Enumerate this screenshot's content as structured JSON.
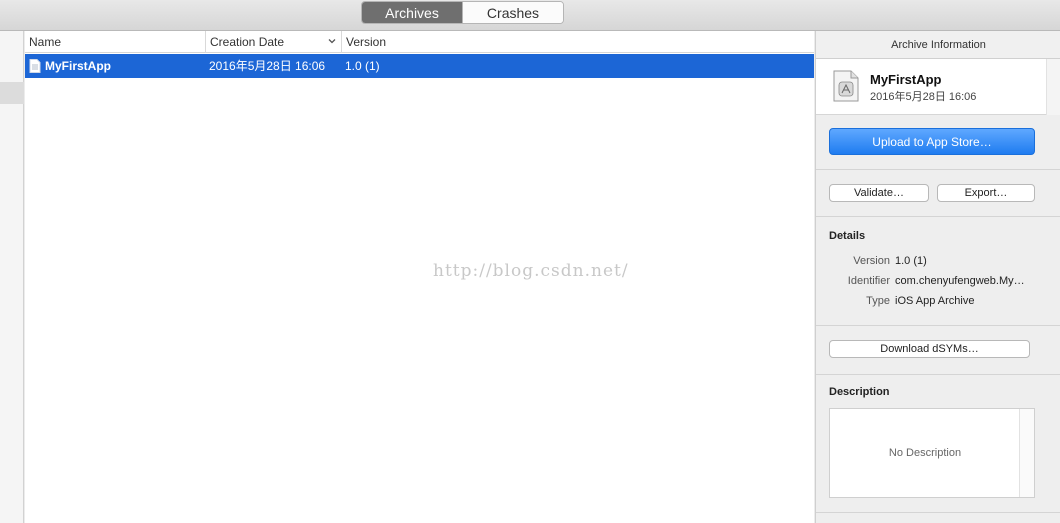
{
  "toolbar": {
    "tabs": [
      {
        "label": "Archives",
        "active": true
      },
      {
        "label": "Crashes",
        "active": false
      }
    ]
  },
  "table": {
    "columns": [
      "Name",
      "Creation Date",
      "Version"
    ],
    "rows": [
      {
        "name": "MyFirstApp",
        "date": "2016年5月28日 16:06",
        "version": "1.0 (1)",
        "selected": true
      }
    ]
  },
  "watermark": "http://blog.csdn.net/",
  "panel": {
    "title": "Archive Information",
    "app_name": "MyFirstApp",
    "app_date": "2016年5月28日 16:06",
    "upload_label": "Upload to App Store…",
    "validate_label": "Validate…",
    "export_label": "Export…",
    "details_title": "Details",
    "details": [
      {
        "label": "Version",
        "value": "1.0 (1)"
      },
      {
        "label": "Identifier",
        "value": "com.chenyufengweb.My…"
      },
      {
        "label": "Type",
        "value": "iOS App Archive"
      }
    ],
    "dsyms_label": "Download dSYMs…",
    "description_title": "Description",
    "description_placeholder": "No Description"
  },
  "colors": {
    "selection": "#1c66d6",
    "primary_button": "#1f7cf0",
    "active_tab": "#6f6f6f"
  }
}
